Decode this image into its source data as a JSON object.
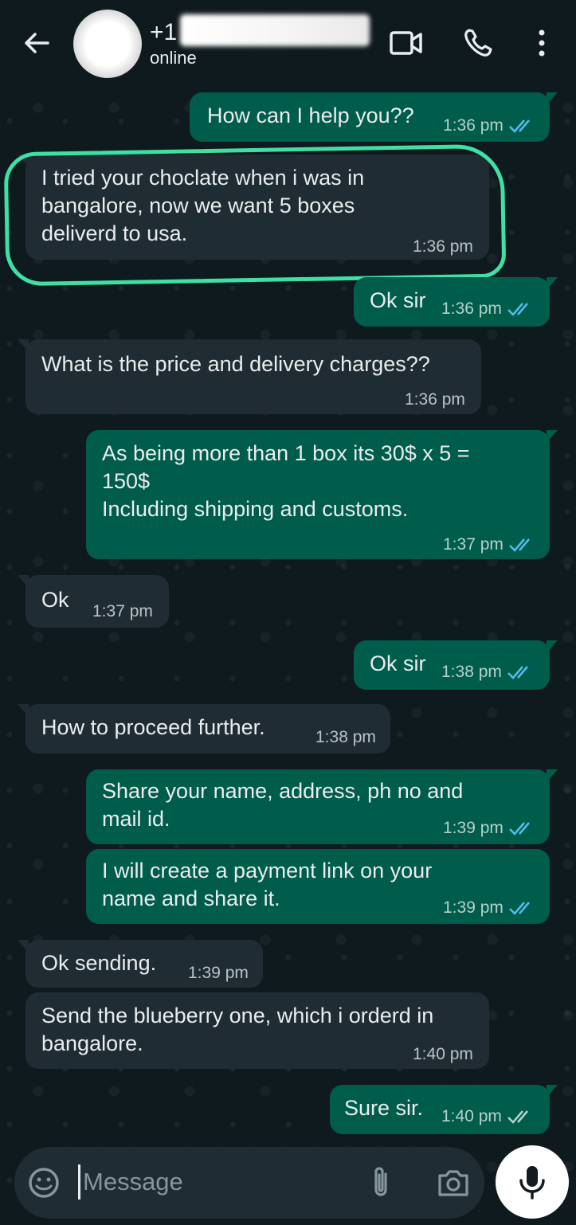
{
  "header": {
    "contact_name_prefix": "+1",
    "contact_status": "online",
    "icons": [
      "back-arrow-icon",
      "avatar",
      "video-call-icon",
      "phone-icon",
      "more-vert-icon"
    ]
  },
  "messages": [
    {
      "dir": "out",
      "text": "How can I help you??",
      "time": "1:36 pm",
      "read": true
    },
    {
      "dir": "in",
      "text": "I tried your choclate when i was in\nbangalore, now we want 5 boxes\ndeliverd to usa.",
      "time": "1:36 pm"
    },
    {
      "dir": "out",
      "text": "Ok sir",
      "time": "1:36 pm",
      "read": true
    },
    {
      "dir": "in",
      "text": "What is the price and delivery charges??",
      "time": "1:36 pm"
    },
    {
      "dir": "out",
      "text": "As being more than 1 box its 30$ x 5 =\n150$\nIncluding shipping and customs.",
      "time": "1:37 pm",
      "read": true
    },
    {
      "dir": "in",
      "text": "Ok",
      "time": "1:37 pm"
    },
    {
      "dir": "out",
      "text": "Ok sir",
      "time": "1:38 pm",
      "read": true
    },
    {
      "dir": "in",
      "text": "How to proceed further.",
      "time": "1:38 pm"
    },
    {
      "dir": "out",
      "text": "Share your name, address, ph no and\nmail id.",
      "time": "1:39 pm",
      "read": true
    },
    {
      "dir": "out",
      "text": "I will create a payment link on your\nname and share it.",
      "time": "1:39 pm",
      "read": true
    },
    {
      "dir": "in",
      "text": "Ok sending.",
      "time": "1:39 pm"
    },
    {
      "dir": "in",
      "text": "Send the blueberry one, which i orderd in\nbangalore.",
      "time": "1:40 pm"
    },
    {
      "dir": "out",
      "text": "Sure sir.",
      "time": "1:40 pm",
      "read": true
    }
  ],
  "input": {
    "placeholder": "Message"
  },
  "colors": {
    "background": "#0b141a",
    "incoming_bubble": "#1f2c33",
    "outgoing_bubble": "#005c4b",
    "read_ticks": "#53bdeb",
    "highlight": "#3fe0a3"
  }
}
